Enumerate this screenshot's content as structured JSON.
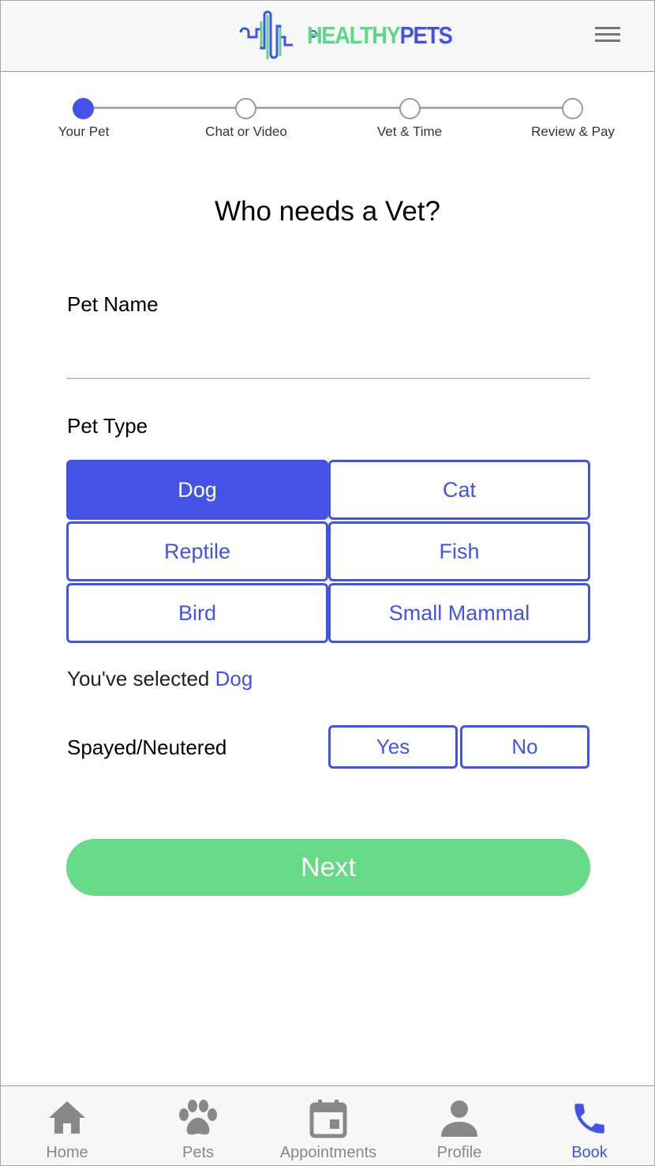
{
  "header": {
    "logo_healthy": "HEALTHY",
    "logo_pets": "PETS",
    "menu_icon": "hamburger-menu-icon"
  },
  "stepper": {
    "steps": [
      {
        "label": "Your Pet",
        "active": true
      },
      {
        "label": "Chat or Video",
        "active": false
      },
      {
        "label": "Vet & Time",
        "active": false
      },
      {
        "label": "Review & Pay",
        "active": false
      }
    ]
  },
  "form": {
    "title": "Who needs a Vet?",
    "pet_name_label": "Pet Name",
    "pet_name_value": "",
    "pet_type_label": "Pet Type",
    "pet_types": [
      "Dog",
      "Cat",
      "Reptile",
      "Fish",
      "Bird",
      "Small Mammal"
    ],
    "selected_type": "Dog",
    "selected_prefix": "You've selected",
    "spayed_label": "Spayed/Neutered",
    "yes_label": "Yes",
    "no_label": "No",
    "next_label": "Next"
  },
  "bottom_nav": {
    "items": [
      {
        "label": "Home",
        "icon": "home-icon",
        "active": false
      },
      {
        "label": "Pets",
        "icon": "paw-icon",
        "active": false
      },
      {
        "label": "Appointments",
        "icon": "calendar-icon",
        "active": false
      },
      {
        "label": "Profile",
        "icon": "person-icon",
        "active": false
      },
      {
        "label": "Book",
        "icon": "phone-icon",
        "active": true
      }
    ]
  },
  "colors": {
    "accent": "#4353e8",
    "green": "#66da86",
    "inactive": "#888888"
  }
}
